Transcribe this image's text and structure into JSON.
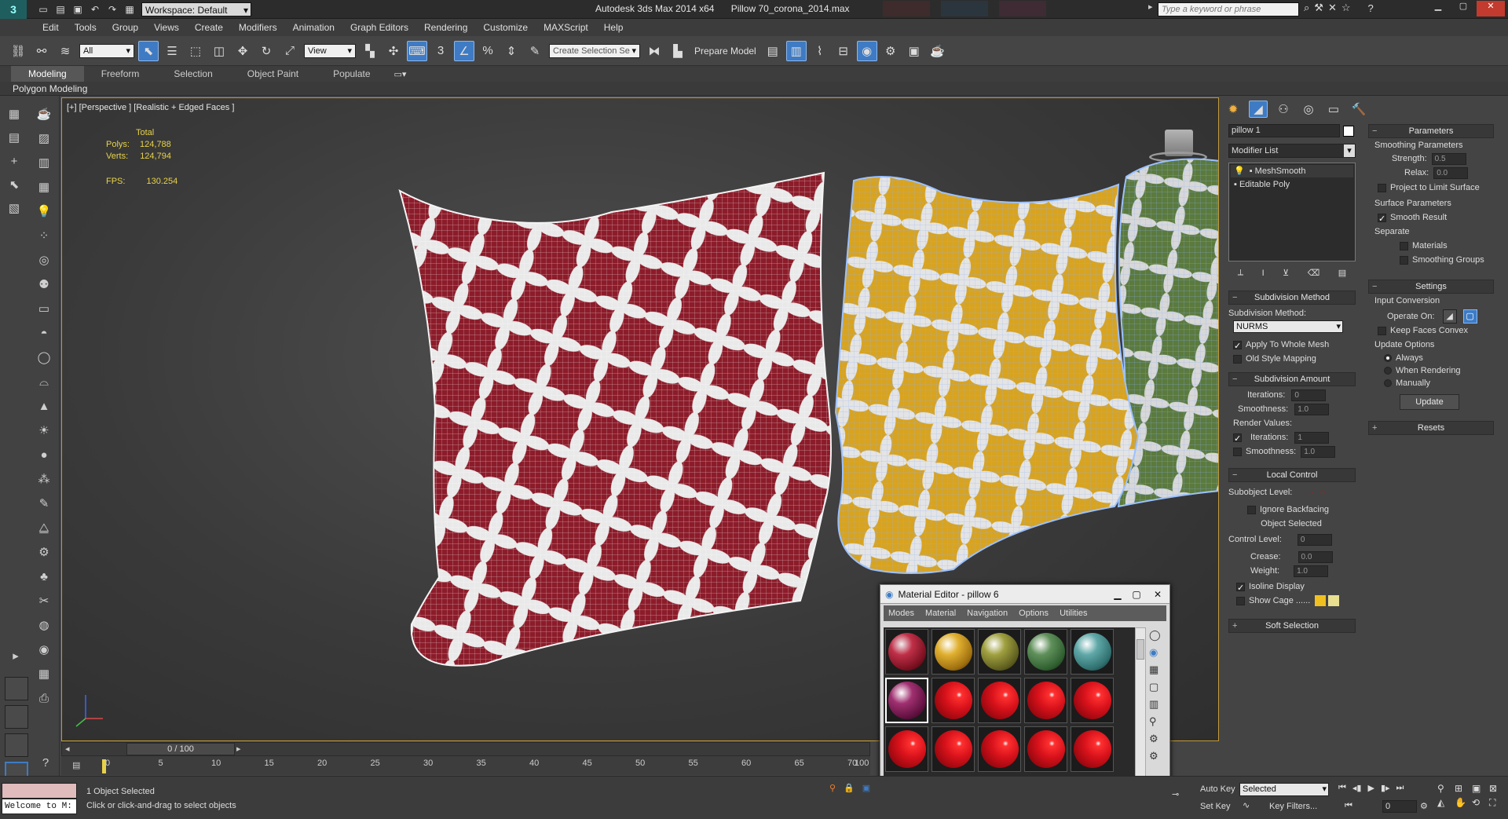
{
  "titlebar": {
    "workspace": "Workspace: Default",
    "app_title": "Autodesk 3ds Max  2014 x64",
    "file_name": "Pillow 70_corona_2014.max",
    "search_placeholder": "Type a keyword or phrase"
  },
  "menu": [
    "Edit",
    "Tools",
    "Group",
    "Views",
    "Create",
    "Modifiers",
    "Animation",
    "Graph Editors",
    "Rendering",
    "Customize",
    "MAXScript",
    "Help"
  ],
  "toolbar": {
    "filter_value": "All",
    "refcoord_value": "View",
    "selection_set_placeholder": "Create Selection Se",
    "prepare_model_label": "Prepare Model"
  },
  "ribbon": {
    "tabs": [
      "Modeling",
      "Freeform",
      "Selection",
      "Object Paint",
      "Populate"
    ],
    "active_tab": "Modeling",
    "sub_label": "Polygon Modeling"
  },
  "viewport": {
    "label": "[+] [Perspective ] [Realistic + Edged Faces ]",
    "total_label": "Total",
    "polys_label": "Polys:",
    "polys_value": "124,788",
    "verts_label": "Verts:",
    "verts_value": "124,794",
    "fps_label": "FPS:",
    "fps_value": "130.254"
  },
  "command_panel": {
    "object_name": "pillow 1",
    "modifier_list": "Modifier List",
    "stack": [
      "MeshSmooth",
      "Editable Poly"
    ],
    "subdivision_method": {
      "title": "Subdivision Method",
      "label": "Subdivision Method:",
      "value": "NURMS",
      "apply_whole_mesh": "Apply To Whole Mesh",
      "old_style_mapping": "Old Style Mapping"
    },
    "subdivision_amount": {
      "title": "Subdivision Amount",
      "iterations_label": "Iterations:",
      "iterations_value": "0",
      "smoothness_label": "Smoothness:",
      "smoothness_value": "1.0",
      "render_values_label": "Render Values:",
      "render_iterations_label": "Iterations:",
      "render_iterations_value": "1",
      "render_smoothness_label": "Smoothness:",
      "render_smoothness_value": "1.0"
    },
    "local_control": {
      "title": "Local Control",
      "subobject_label": "Subobject Level:",
      "ignore_backfacing": "Ignore Backfacing",
      "object_selected": "Object Selected",
      "control_level_label": "Control Level:",
      "control_level_value": "0",
      "crease_label": "Crease:",
      "crease_value": "0.0",
      "weight_label": "Weight:",
      "weight_value": "1.0",
      "isoline_display": "Isoline Display",
      "show_cage": "Show Cage ......"
    },
    "soft_selection": "Soft Selection",
    "parameters": {
      "title": "Parameters",
      "smoothing_params": "Smoothing Parameters",
      "strength_label": "Strength:",
      "strength_value": "0.5",
      "relax_label": "Relax:",
      "relax_value": "0.0",
      "project_limit": "Project to Limit Surface",
      "surface_params": "Surface Parameters",
      "smooth_result": "Smooth Result",
      "separate_label": "Separate",
      "materials": "Materials",
      "smoothing_groups": "Smoothing Groups"
    },
    "settings": {
      "title": "Settings",
      "input_conversion": "Input Conversion",
      "operate_on": "Operate On:",
      "keep_faces_convex": "Keep Faces Convex",
      "update_options": "Update Options",
      "always": "Always",
      "when_rendering": "When Rendering",
      "manually": "Manually",
      "update_button": "Update"
    },
    "resets": "Resets"
  },
  "material_editor": {
    "title": "Material Editor - pillow 6",
    "menus": [
      "Modes",
      "Material",
      "Navigation",
      "Options",
      "Utilities"
    ]
  },
  "timeline": {
    "frame_counter": "0 / 100",
    "ticks": [
      "0",
      "5",
      "10",
      "15",
      "20",
      "25",
      "30",
      "35",
      "40",
      "45",
      "50",
      "55",
      "60",
      "65",
      "70"
    ],
    "end_tick": "100"
  },
  "status": {
    "maxscript": "Welcome to M:",
    "selection_info": "1 Object Selected",
    "prompt": "Click or click-and-drag to select objects",
    "auto_key": "Auto Key",
    "set_key": "Set Key",
    "selected_value": "Selected",
    "key_filters": "Key Filters...",
    "frame_value": "0"
  },
  "colors": {
    "accent": "#3e7bc4",
    "viewport_border": "#c29a3b",
    "pillow_red": "#8c1c2a",
    "pillow_yellow": "#d8a31f",
    "pillow_green": "#5b7a3d",
    "material_red": "#d8121b"
  }
}
